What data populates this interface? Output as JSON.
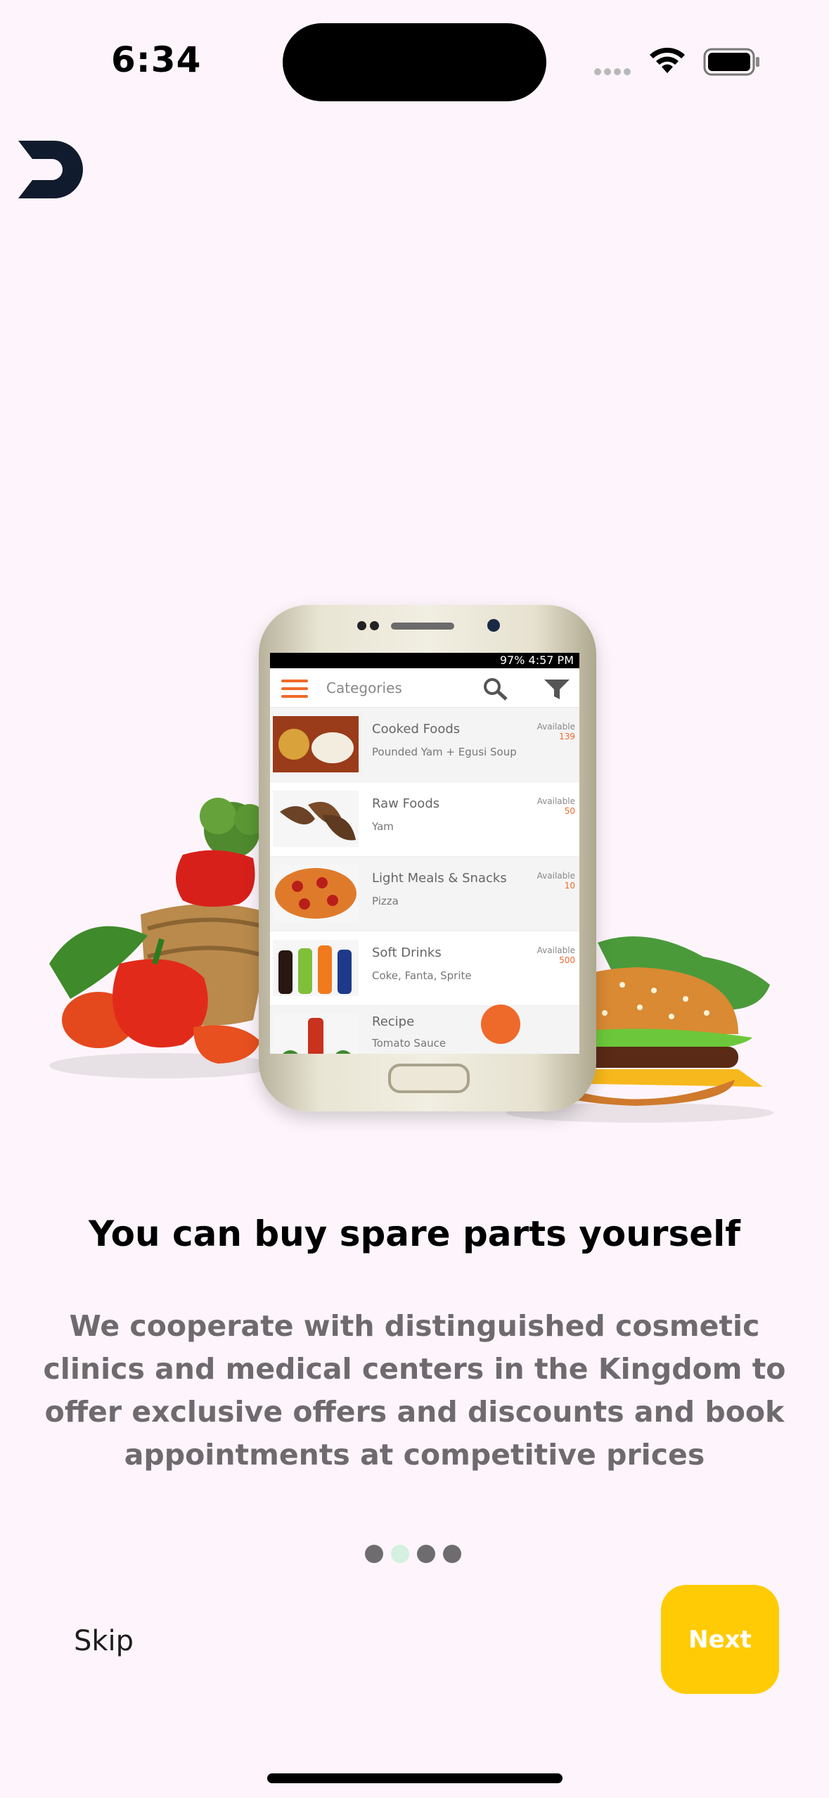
{
  "status_bar": {
    "time": "6:34",
    "icons": [
      "signal-icon",
      "wifi-icon",
      "battery-icon"
    ]
  },
  "logo": "app-logo",
  "illustration": {
    "phone_status": "97%  4:57 PM",
    "toolbar_title": "Categories",
    "categories": [
      {
        "name": "Cooked Foods",
        "sub": "Pounded Yam + Egusi Soup",
        "available_label": "Available",
        "count": "139"
      },
      {
        "name": "Raw Foods",
        "sub": "Yam",
        "available_label": "Available",
        "count": "50"
      },
      {
        "name": "Light Meals & Snacks",
        "sub": "Pizza",
        "available_label": "Available",
        "count": "10"
      },
      {
        "name": "Soft Drinks",
        "sub": "Coke, Fanta, Sprite",
        "available_label": "Available",
        "count": "500"
      },
      {
        "name": "Recipe",
        "sub": "Tomato Sauce",
        "available_label": "",
        "count": ""
      }
    ]
  },
  "onboarding": {
    "title": "You can buy spare parts yourself",
    "description": "We cooperate with distinguished cosmetic clinics and medical centers in the Kingdom to offer exclusive offers and discounts and book appointments at competitive prices",
    "page_count": 4,
    "active_page": 2
  },
  "buttons": {
    "skip": "Skip",
    "next": "Next"
  },
  "colors": {
    "background": "#fdf5fb",
    "accent": "#ffcb05",
    "dot_active": "#d5efe0",
    "dot_inactive": "#6f6c70"
  }
}
